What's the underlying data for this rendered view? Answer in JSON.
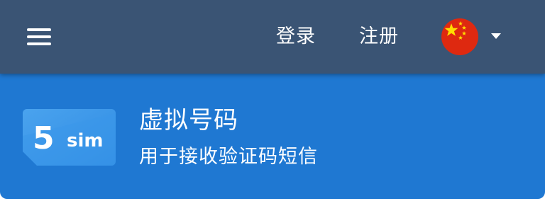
{
  "header": {
    "menu_icon": "hamburger-menu-icon",
    "login_label": "登录",
    "register_label": "注册",
    "language": {
      "flag_icon": "china-flag-icon",
      "dropdown_icon": "caret-down-icon"
    },
    "background_color": "#3a5474"
  },
  "hero": {
    "logo": {
      "number": "5",
      "text": "sim"
    },
    "title": "虚拟号码",
    "subtitle": "用于接收验证码短信",
    "background_color": "#1f78d2"
  }
}
